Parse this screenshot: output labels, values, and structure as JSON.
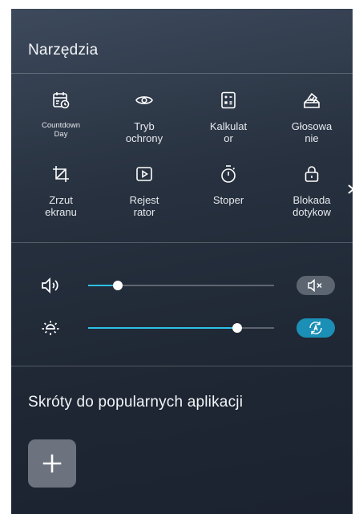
{
  "tools_section": {
    "title": "Narzędzia",
    "items": [
      {
        "label": "Countdown\nDay",
        "icon": "calendar-clock-icon"
      },
      {
        "label": "Tryb\nochrony",
        "icon": "eye-icon"
      },
      {
        "label": "Kalkulat\nor",
        "icon": "calculator-icon"
      },
      {
        "label": "Głosowa\nnie",
        "icon": "vote-box-icon"
      },
      {
        "label": "Zrzut\nekranu",
        "icon": "crop-icon"
      },
      {
        "label": "Rejest\nrator",
        "icon": "screen-recorder-icon"
      },
      {
        "label": "Stoper",
        "icon": "stopwatch-icon"
      },
      {
        "label": "Blokada\ndotykow",
        "icon": "lock-icon"
      }
    ],
    "next_icon": "chevron-right-icon"
  },
  "sliders": {
    "volume": {
      "icon": "speaker-icon",
      "level": 0.16,
      "toggle_icon": "mute-icon",
      "toggle_color": "#5d6570"
    },
    "brightness": {
      "icon": "sun-icon",
      "level": 0.8,
      "toggle_icon": "auto-brightness-icon",
      "toggle_color": "#1b8fb5"
    },
    "accent_color": "#2bc1e6"
  },
  "shortcuts_section": {
    "title": "Skróty do popularnych aplikacji",
    "add_icon": "plus-icon"
  }
}
